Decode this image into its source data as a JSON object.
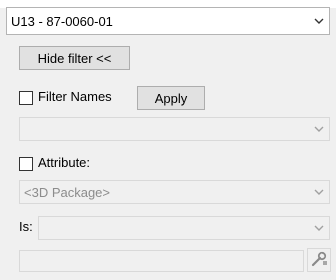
{
  "selector": {
    "value": "U13 - 87-0060-01"
  },
  "hide_filter": {
    "label": "Hide filter <<"
  },
  "filter_names": {
    "label": "Filter Names",
    "checked": false
  },
  "apply": {
    "label": "Apply"
  },
  "names_combo": {
    "value": ""
  },
  "attribute": {
    "label": "Attribute:",
    "checked": false
  },
  "attribute_combo": {
    "value": "<3D Package>"
  },
  "is_row": {
    "label": "Is:",
    "value": ""
  },
  "value_field": {
    "value": ""
  },
  "icons": {
    "dropdown": "chevron-down-icon",
    "pick": "wrench-pick-icon"
  },
  "colors": {
    "background": "#f0f0f0",
    "border": "#b4b4b4",
    "disabled_text": "#8c8c8c"
  }
}
